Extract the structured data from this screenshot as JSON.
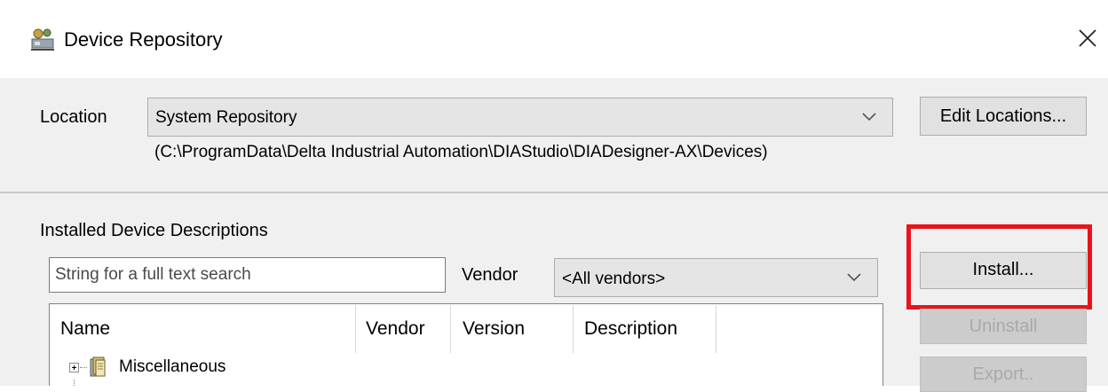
{
  "window": {
    "title": "Device Repository",
    "icon": "device-repository-icon",
    "close_icon": "close-icon"
  },
  "location": {
    "label": "Location",
    "selected": "System Repository",
    "path": "(C:\\ProgramData\\Delta Industrial Automation\\DIAStudio\\DIADesigner-AX\\Devices)",
    "edit_button": "Edit Locations..."
  },
  "installed": {
    "label": "Installed Device Descriptions",
    "search_placeholder": "String for a full text search",
    "vendor_label": "Vendor",
    "vendor_selected": "<All vendors>",
    "columns": [
      "Name",
      "Vendor",
      "Version",
      "Description"
    ],
    "tree": [
      {
        "label": "Miscellaneous",
        "icon": "folder-icon",
        "expanded": false
      }
    ]
  },
  "buttons": {
    "install": "Install...",
    "uninstall": "Uninstall",
    "export": "Export.."
  },
  "colors": {
    "highlight": "#e8141c",
    "dialog_bg": "#f0f0f0"
  }
}
